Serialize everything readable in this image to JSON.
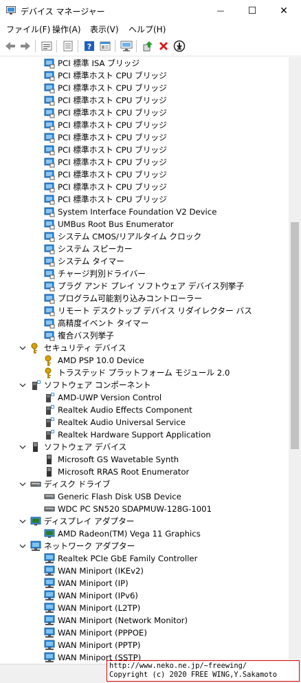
{
  "window": {
    "title": "デバイス マネージャー",
    "minimize_glyph": "—",
    "maximize_glyph": "☐",
    "close_glyph": "✕"
  },
  "menu": [
    {
      "label": "ファイル(F)"
    },
    {
      "label": "操作(A)"
    },
    {
      "label": "表示(V)"
    },
    {
      "label": "ヘルプ(H)"
    }
  ],
  "toolbar": [
    "back-icon",
    "forward-icon",
    "properties-icon",
    "show-hidden-icon",
    "help-icon",
    "action-icon",
    "monitor-icon",
    "update-driver-icon",
    "uninstall-icon",
    "disable-icon"
  ],
  "colors": {
    "folder_blue": "#2a86d9",
    "uninstall_red": "#d91c1c",
    "update_green": "#2d9a33"
  },
  "tree": [
    {
      "kind": "device",
      "icon": "sysdev",
      "label": "PCI 標準 ISA ブリッジ"
    },
    {
      "kind": "device",
      "icon": "sysdev",
      "label": "PCI 標準ホスト CPU ブリッジ"
    },
    {
      "kind": "device",
      "icon": "sysdev",
      "label": "PCI 標準ホスト CPU ブリッジ"
    },
    {
      "kind": "device",
      "icon": "sysdev",
      "label": "PCI 標準ホスト CPU ブリッジ"
    },
    {
      "kind": "device",
      "icon": "sysdev",
      "label": "PCI 標準ホスト CPU ブリッジ"
    },
    {
      "kind": "device",
      "icon": "sysdev",
      "label": "PCI 標準ホスト CPU ブリッジ"
    },
    {
      "kind": "device",
      "icon": "sysdev",
      "label": "PCI 標準ホスト CPU ブリッジ"
    },
    {
      "kind": "device",
      "icon": "sysdev",
      "label": "PCI 標準ホスト CPU ブリッジ"
    },
    {
      "kind": "device",
      "icon": "sysdev",
      "label": "PCI 標準ホスト CPU ブリッジ"
    },
    {
      "kind": "device",
      "icon": "sysdev",
      "label": "PCI 標準ホスト CPU ブリッジ"
    },
    {
      "kind": "device",
      "icon": "sysdev",
      "label": "PCI 標準ホスト CPU ブリッジ"
    },
    {
      "kind": "device",
      "icon": "sysdev",
      "label": "PCI 標準ホスト CPU ブリッジ"
    },
    {
      "kind": "device",
      "icon": "sysdev",
      "label": "System Interface Foundation V2 Device"
    },
    {
      "kind": "device",
      "icon": "sysdev",
      "label": "UMBus Root Bus Enumerator"
    },
    {
      "kind": "device",
      "icon": "sysdev",
      "label": "システム CMOS/リアルタイム クロック"
    },
    {
      "kind": "device",
      "icon": "sysdev",
      "label": "システム スピーカー"
    },
    {
      "kind": "device",
      "icon": "sysdev",
      "label": "システム タイマー"
    },
    {
      "kind": "device",
      "icon": "sysdev",
      "label": "チャージ判別ドライバー"
    },
    {
      "kind": "device",
      "icon": "sysdev",
      "label": "プラグ アンド プレイ ソフトウェア デバイス列挙子"
    },
    {
      "kind": "device",
      "icon": "sysdev",
      "label": "プログラム可能割り込みコントローラー"
    },
    {
      "kind": "device",
      "icon": "sysdev",
      "label": "リモート デスクトップ デバイス リダイレクター バス"
    },
    {
      "kind": "device",
      "icon": "sysdev",
      "label": "高精度イベント タイマー"
    },
    {
      "kind": "device",
      "icon": "sysdev",
      "label": "複合バス列挙子"
    },
    {
      "kind": "category",
      "icon": "key",
      "label": "セキュリティ デバイス"
    },
    {
      "kind": "device",
      "icon": "key",
      "label": "AMD PSP 10.0 Device"
    },
    {
      "kind": "device",
      "icon": "key",
      "label": "トラステッド プラットフォーム モジュール 2.0"
    },
    {
      "kind": "category",
      "icon": "swcomp",
      "label": "ソフトウェア コンポーネント"
    },
    {
      "kind": "device",
      "icon": "swcomp",
      "label": "AMD-UWP Version Control"
    },
    {
      "kind": "device",
      "icon": "swcomp",
      "label": "Realtek Audio Effects Component"
    },
    {
      "kind": "device",
      "icon": "swcomp",
      "label": "Realtek Audio Universal Service"
    },
    {
      "kind": "device",
      "icon": "swcomp",
      "label": "Realtek Hardware Support Application"
    },
    {
      "kind": "category",
      "icon": "swdev",
      "label": "ソフトウェア デバイス"
    },
    {
      "kind": "device",
      "icon": "swdev",
      "label": "Microsoft GS Wavetable Synth"
    },
    {
      "kind": "device",
      "icon": "swdev",
      "label": "Microsoft RRAS Root Enumerator"
    },
    {
      "kind": "category",
      "icon": "disk",
      "label": "ディスク ドライブ"
    },
    {
      "kind": "device",
      "icon": "disk",
      "label": "Generic Flash Disk USB Device"
    },
    {
      "kind": "device",
      "icon": "disk",
      "label": "WDC PC SN520 SDAPMUW-128G-1001"
    },
    {
      "kind": "category",
      "icon": "display",
      "label": "ディスプレイ アダプター"
    },
    {
      "kind": "device",
      "icon": "display",
      "label": "AMD Radeon(TM) Vega 11 Graphics"
    },
    {
      "kind": "category",
      "icon": "net",
      "label": "ネットワーク アダプター"
    },
    {
      "kind": "device",
      "icon": "net",
      "label": "Realtek PCIe GbE Family Controller"
    },
    {
      "kind": "device",
      "icon": "net",
      "label": "WAN Miniport (IKEv2)"
    },
    {
      "kind": "device",
      "icon": "net",
      "label": "WAN Miniport (IP)"
    },
    {
      "kind": "device",
      "icon": "net",
      "label": "WAN Miniport (IPv6)"
    },
    {
      "kind": "device",
      "icon": "net",
      "label": "WAN Miniport (L2TP)"
    },
    {
      "kind": "device",
      "icon": "net",
      "label": "WAN Miniport (Network Monitor)"
    },
    {
      "kind": "device",
      "icon": "net",
      "label": "WAN Miniport (PPPOE)"
    },
    {
      "kind": "device",
      "icon": "net",
      "label": "WAN Miniport (PPTP)"
    },
    {
      "kind": "device",
      "icon": "net",
      "label": "WAN Miniport (SSTP)"
    }
  ],
  "credit": {
    "line1": "http://www.neko.ne.jp/~freewing/",
    "line2": "Copyright (c) 2020 FREE WING,Y.Sakamoto"
  }
}
